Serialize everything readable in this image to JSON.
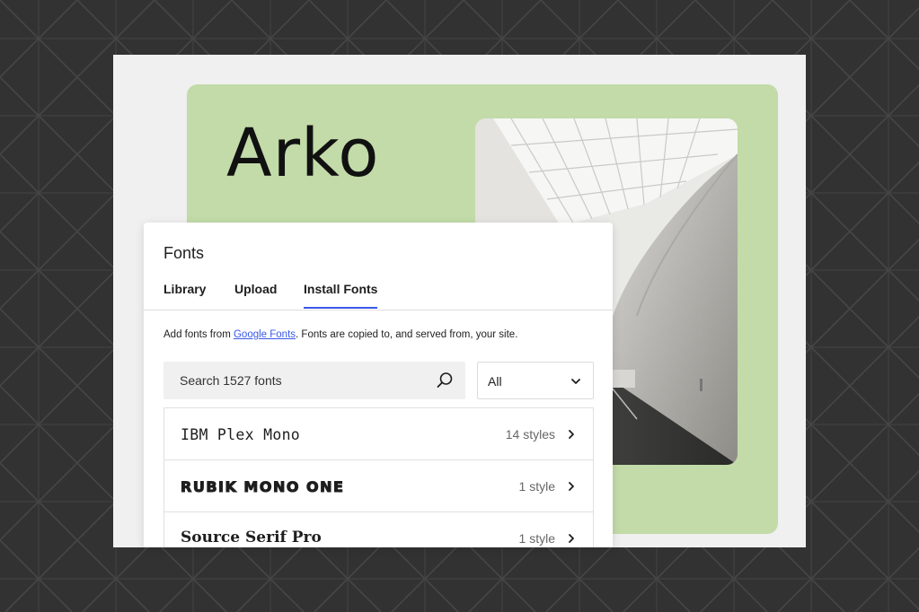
{
  "hero": {
    "title": "Arko"
  },
  "panel": {
    "title": "Fonts",
    "tabs": [
      {
        "label": "Library"
      },
      {
        "label": "Upload"
      },
      {
        "label": "Install Fonts"
      }
    ],
    "active_tab": "Install Fonts",
    "description": {
      "prefix": "Add fonts from ",
      "link": "Google Fonts",
      "suffix": ". Fonts are copied to, and served from, your site."
    },
    "search": {
      "placeholder": "Search 1527 fonts"
    },
    "category_select": {
      "value": "All"
    },
    "fonts": [
      {
        "name": "IBM Plex Mono",
        "styles": "14 styles"
      },
      {
        "name": "RUBIK MONO ONE",
        "styles": "1 style"
      },
      {
        "name": "Source Serif Pro",
        "styles": "1 style"
      }
    ]
  },
  "colors": {
    "accent": "#3858e9",
    "hero_background": "#c2dba8",
    "page_background": "#323232"
  },
  "icons": {
    "search": "search-icon",
    "select": "chevron-down-icon",
    "row": "chevron-right-icon"
  }
}
